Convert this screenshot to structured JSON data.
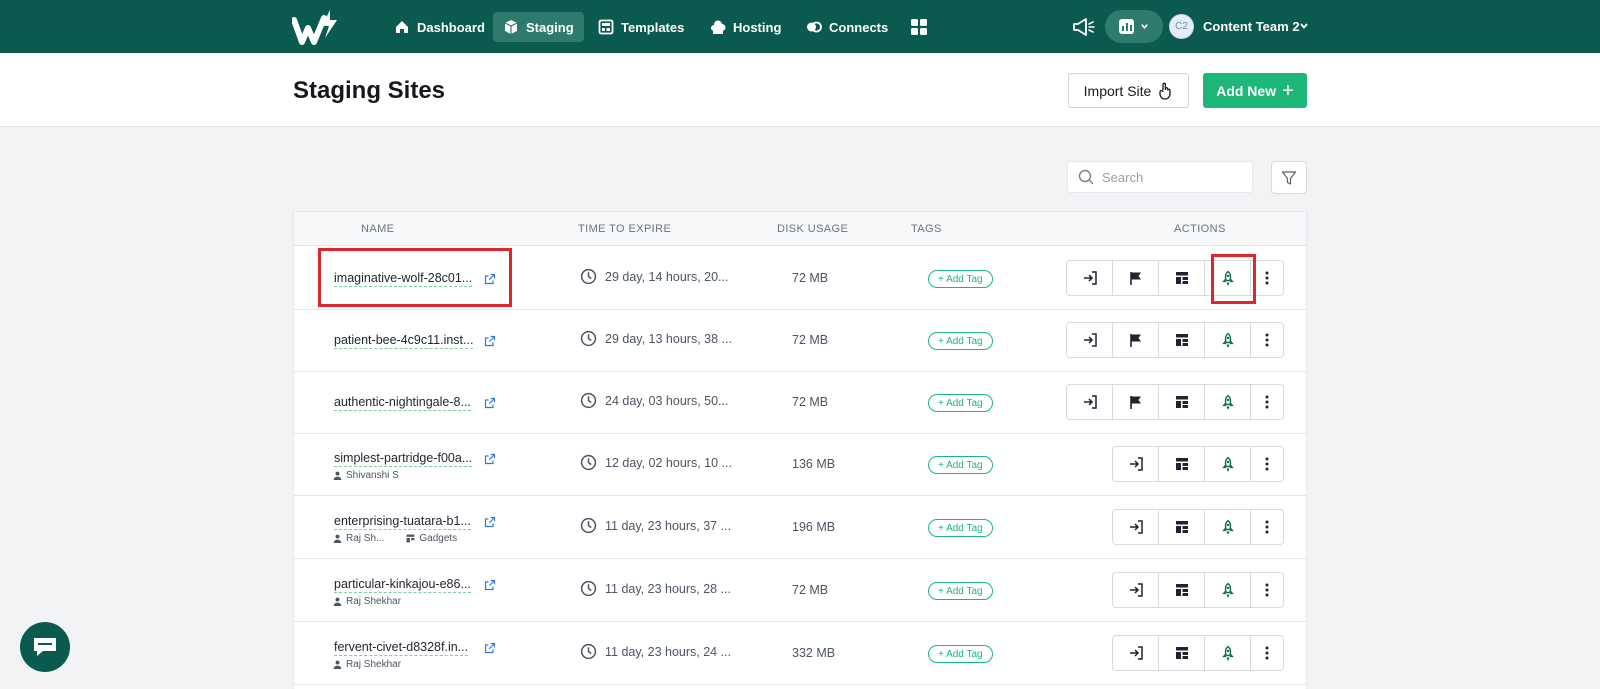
{
  "nav": {
    "items": [
      {
        "label": "Dashboard",
        "icon": "home-icon",
        "active": false
      },
      {
        "label": "Staging",
        "icon": "cube-icon",
        "active": true
      },
      {
        "label": "Templates",
        "icon": "templates-icon",
        "active": false
      },
      {
        "label": "Hosting",
        "icon": "cloud-icon",
        "active": false
      },
      {
        "label": "Connects",
        "icon": "connects-icon",
        "active": false
      }
    ],
    "team_avatar": "C2",
    "team_name": "Content Team 2"
  },
  "header": {
    "title": "Staging Sites",
    "import_label": "Import Site",
    "add_new_label": "Add New",
    "add_new_symbol": "+"
  },
  "search": {
    "placeholder": "Search"
  },
  "table": {
    "headers": {
      "name": "NAME",
      "expire": "TIME TO EXPIRE",
      "disk": "DISK USAGE",
      "tags": "TAGS",
      "actions": "ACTIONS"
    },
    "tag_button_label": "+ Add Tag",
    "rows": [
      {
        "name": "imaginative-wolf-28c01...",
        "expire": "29 day, 14 hours, 20...",
        "disk": "72 MB",
        "owner": "",
        "category": ""
      },
      {
        "name": "patient-bee-4c9c11.inst...",
        "expire": "29 day, 13 hours, 38 ...",
        "disk": "72 MB",
        "owner": "",
        "category": ""
      },
      {
        "name": "authentic-nightingale-8...",
        "expire": "24 day, 03 hours, 50...",
        "disk": "72 MB",
        "owner": "",
        "category": ""
      },
      {
        "name": "simplest-partridge-f00a...",
        "expire": "12 day, 02 hours, 10 ...",
        "disk": "136 MB",
        "owner": "Shivanshi S",
        "category": ""
      },
      {
        "name": "enterprising-tuatara-b1...",
        "expire": "11 day, 23 hours, 37 ...",
        "disk": "196 MB",
        "owner": "Raj Sh...",
        "category": "Gadgets"
      },
      {
        "name": "particular-kinkajou-e86...",
        "expire": "11 day, 23 hours, 28 ...",
        "disk": "72 MB",
        "owner": "Raj Shekhar",
        "category": ""
      },
      {
        "name": "fervent-civet-d8328f.in...",
        "expire": "11 day, 23 hours, 24 ...",
        "disk": "332 MB",
        "owner": "Raj Shekhar",
        "category": ""
      }
    ]
  },
  "colors": {
    "nav_bg": "#0b5a4f",
    "accent_green": "#1db77a",
    "highlight_red": "#e0262a"
  }
}
